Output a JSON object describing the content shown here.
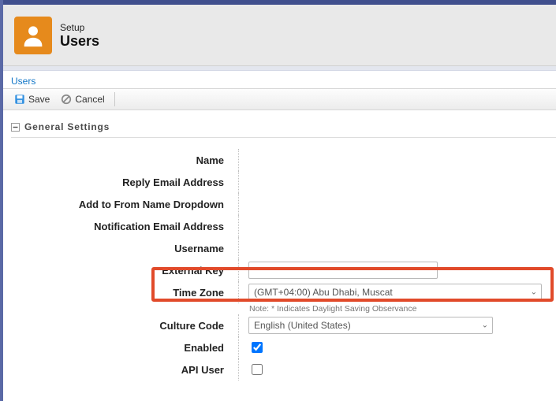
{
  "header": {
    "super": "Setup",
    "title": "Users"
  },
  "breadcrumb": {
    "users": "Users"
  },
  "toolbar": {
    "save": "Save",
    "cancel": "Cancel"
  },
  "section": {
    "title": "General Settings"
  },
  "form": {
    "labels": {
      "name": "Name",
      "reply_email": "Reply Email Address",
      "add_from": "Add to From Name Dropdown",
      "notif_email": "Notification Email Address",
      "username": "Username",
      "external_key": "External Key",
      "time_zone": "Time Zone",
      "culture_code": "Culture Code",
      "enabled": "Enabled",
      "api_user": "API User"
    },
    "values": {
      "time_zone_selected": "(GMT+04:00) Abu Dhabi, Muscat",
      "culture_code_selected": "English (United States)",
      "enabled_checked": "true",
      "api_user_checked": "false",
      "tz_note": "Note: * Indicates Daylight Saving Observance"
    }
  }
}
